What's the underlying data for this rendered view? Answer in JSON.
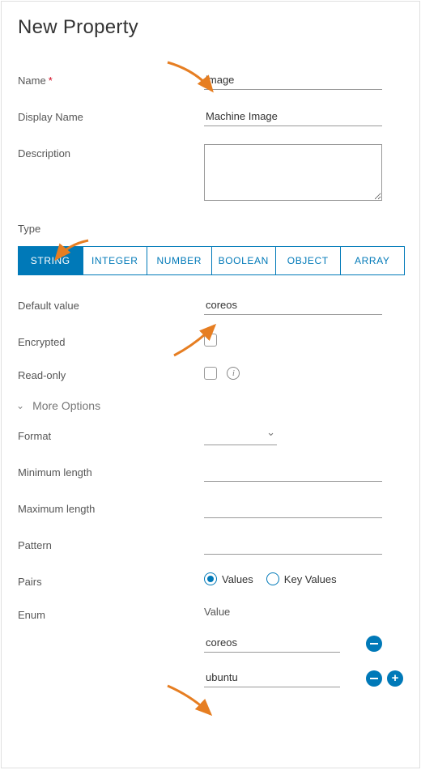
{
  "title": "New Property",
  "labels": {
    "name": "Name",
    "displayName": "Display Name",
    "description": "Description",
    "type": "Type",
    "defaultValue": "Default value",
    "encrypted": "Encrypted",
    "readOnly": "Read-only",
    "moreOptions": "More Options",
    "format": "Format",
    "minLength": "Minimum length",
    "maxLength": "Maximum length",
    "pattern": "Pattern",
    "pairs": "Pairs",
    "enum": "Enum",
    "enumValueHeader": "Value"
  },
  "values": {
    "name": "image",
    "displayName": "Machine Image",
    "description": "",
    "defaultValue": "coreos",
    "encrypted": false,
    "readOnly": false,
    "format": "",
    "minLength": "",
    "maxLength": "",
    "pattern": ""
  },
  "typeTabs": [
    "STRING",
    "INTEGER",
    "NUMBER",
    "BOOLEAN",
    "OBJECT",
    "ARRAY"
  ],
  "typeSelected": "STRING",
  "pairs": {
    "options": [
      "Values",
      "Key Values"
    ],
    "selected": "Values"
  },
  "enumValues": [
    "coreos",
    "ubuntu"
  ]
}
